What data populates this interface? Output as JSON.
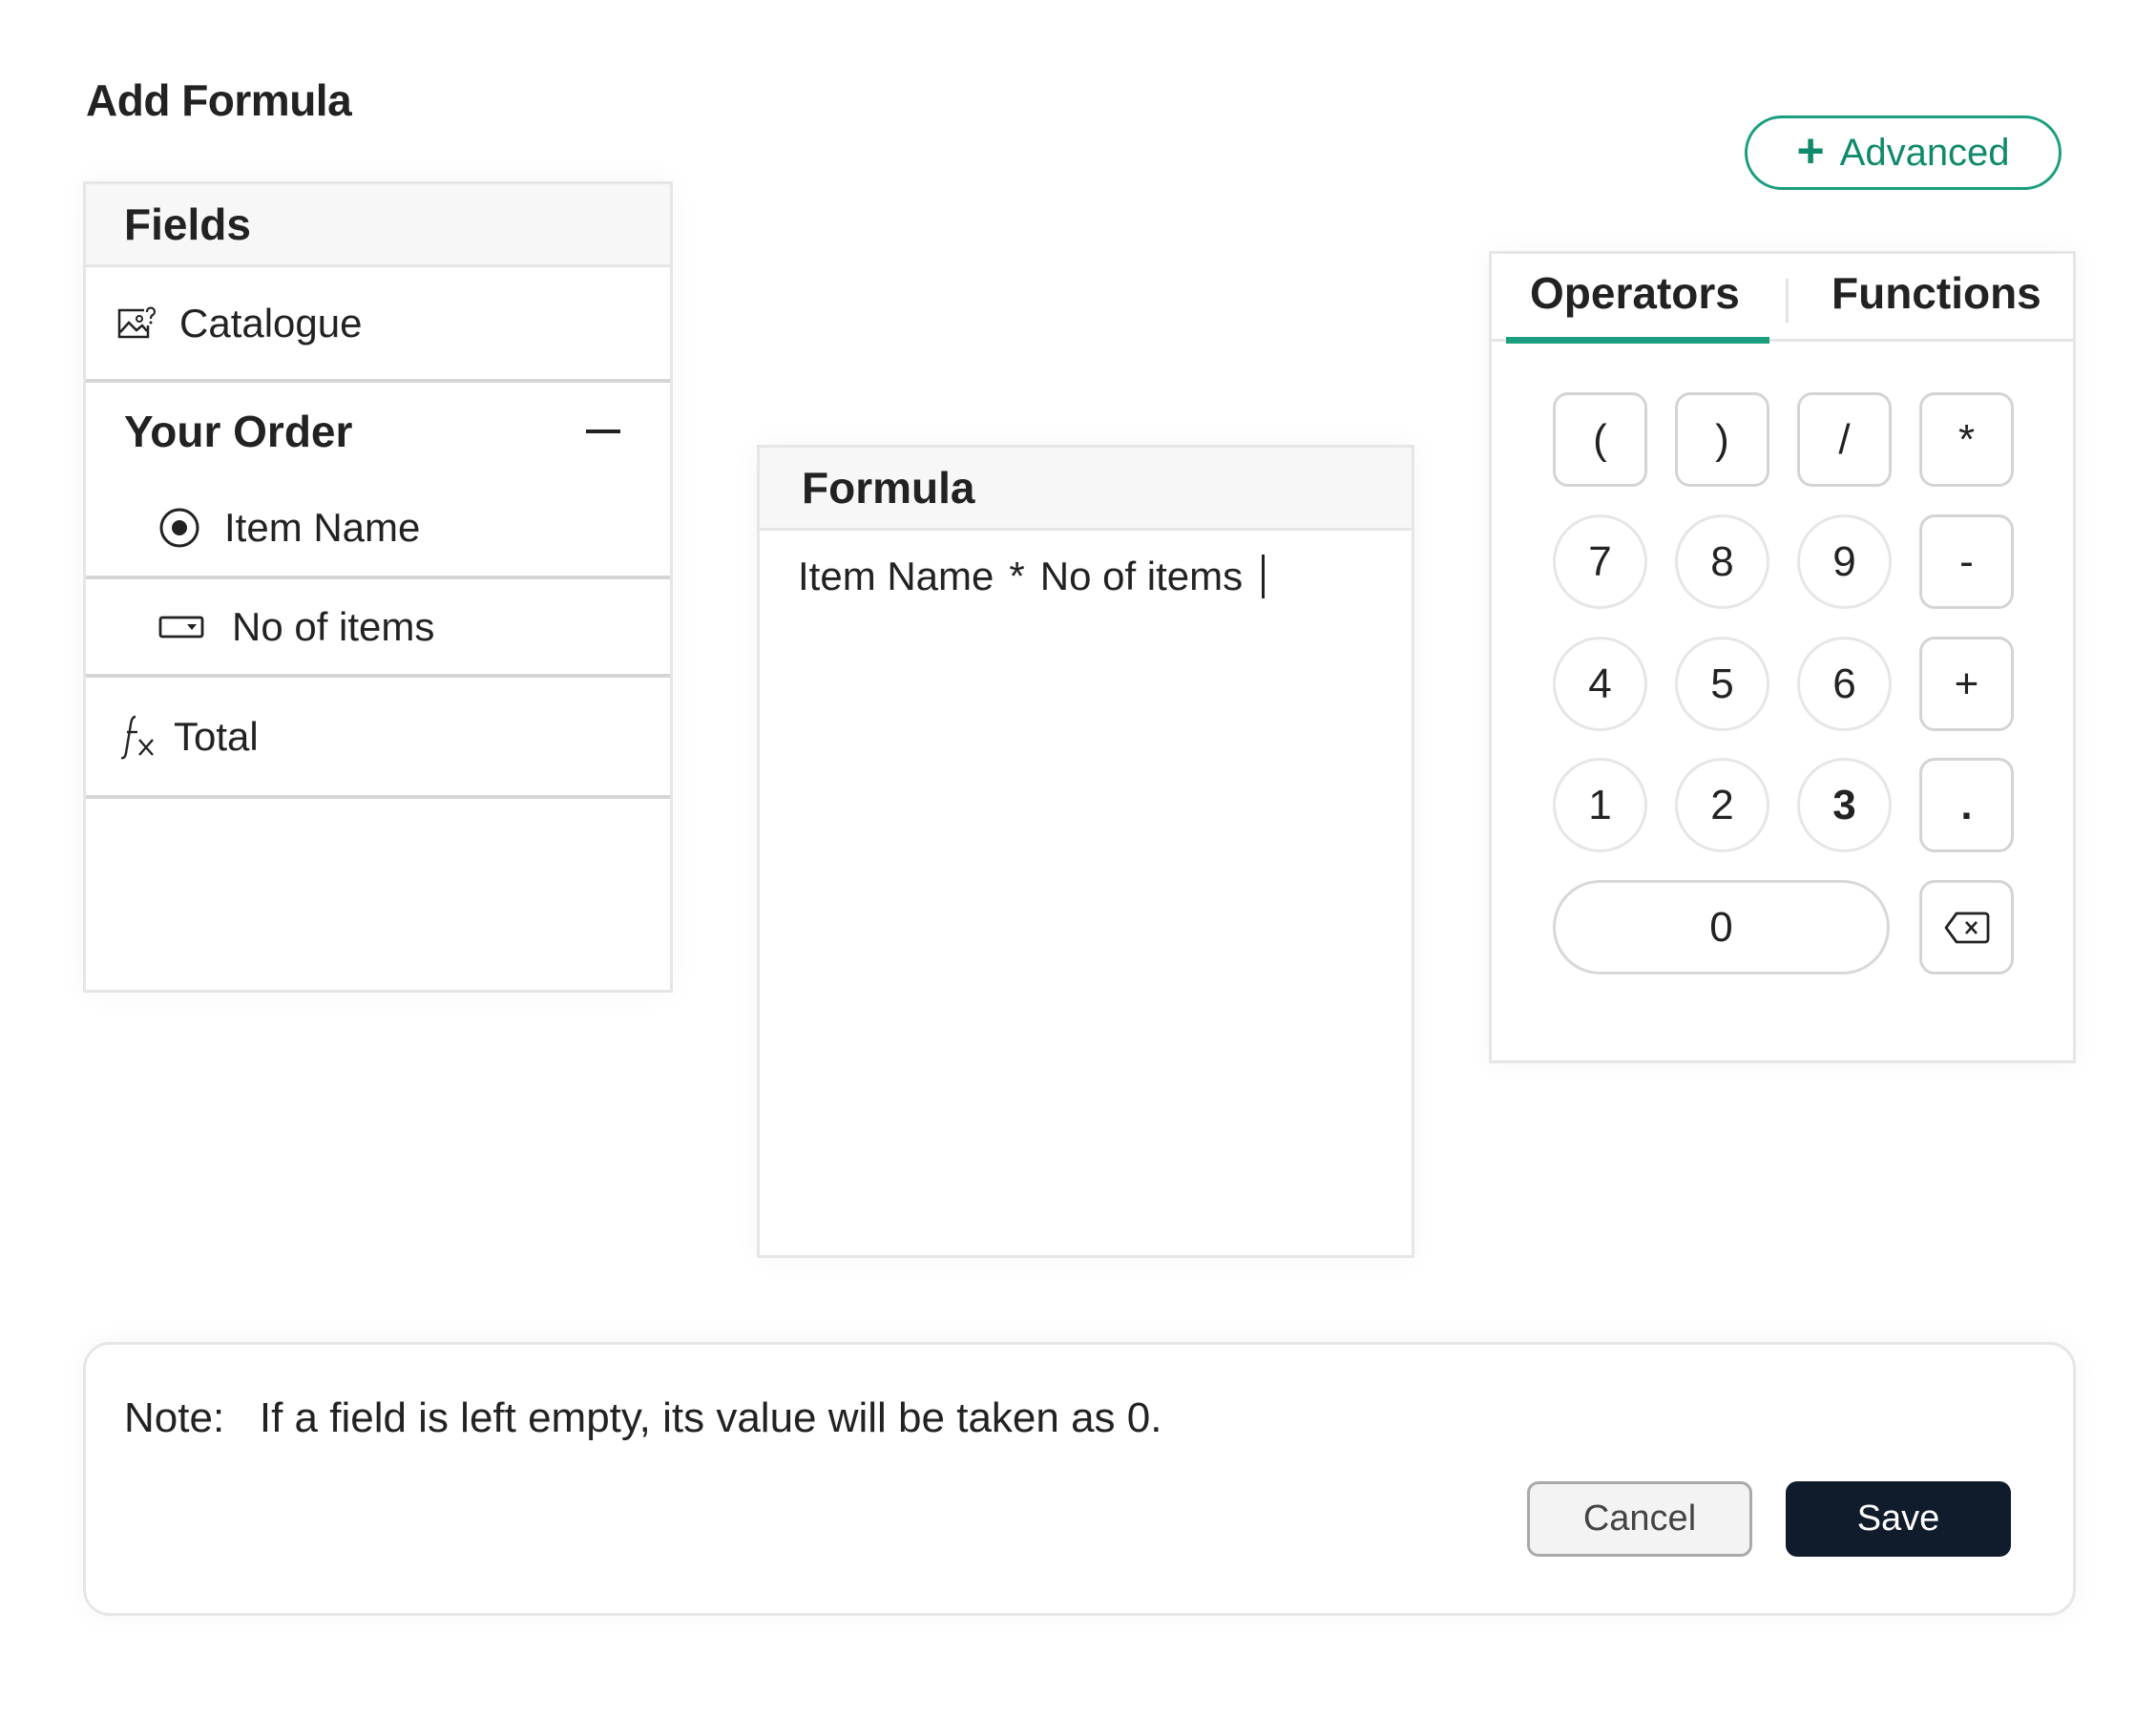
{
  "title": "Add Formula",
  "advanced_button": {
    "label": "Advanced",
    "icon": "plus-icon"
  },
  "fields_panel": {
    "header": "Fields",
    "items": [
      {
        "label": "Catalogue",
        "icon": "image-question-icon"
      },
      {
        "group": "Your Order",
        "expanded": true,
        "collapse_icon": "minus-icon",
        "children": [
          {
            "label": "Item Name",
            "icon": "radio-icon"
          },
          {
            "label": "No of items",
            "icon": "dropdown-field-icon"
          }
        ]
      },
      {
        "label": "Total",
        "icon": "function-fx-icon"
      }
    ]
  },
  "formula_panel": {
    "header": "Formula",
    "tokens": [
      "Item Name",
      "*",
      "No of items"
    ]
  },
  "operators_panel": {
    "tabs": [
      {
        "label": "Operators",
        "active": true
      },
      {
        "label": "Functions",
        "active": false
      }
    ],
    "keys": [
      [
        "(",
        ")",
        "/",
        "*"
      ],
      [
        "7",
        "8",
        "9",
        "-"
      ],
      [
        "4",
        "5",
        "6",
        "+"
      ],
      [
        "1",
        "2",
        "3",
        "."
      ],
      [
        "0",
        "backspace"
      ]
    ]
  },
  "note": {
    "label": "Note:",
    "text": "If a field is left empty, its value will be taken as 0."
  },
  "actions": {
    "cancel_label": "Cancel",
    "save_label": "Save"
  },
  "colors": {
    "accent": "#1a9e7e",
    "save_bg": "#101c2c"
  }
}
